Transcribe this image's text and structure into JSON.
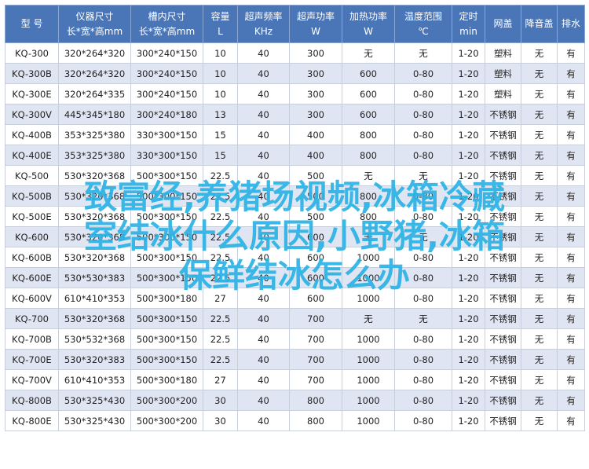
{
  "table": {
    "columns": [
      {
        "line1": "型  号",
        "line2": ""
      },
      {
        "line1": "仪器尺寸",
        "line2": "长*宽*高mm"
      },
      {
        "line1": "槽内尺寸",
        "line2": "长*宽*高mm"
      },
      {
        "line1": "容量",
        "line2": "L"
      },
      {
        "line1": "超声频率",
        "line2": "KHz"
      },
      {
        "line1": "超声功率",
        "line2": "W"
      },
      {
        "line1": "加热功率",
        "line2": "W"
      },
      {
        "line1": "温度范围",
        "line2": "℃"
      },
      {
        "line1": "定时",
        "line2": "min"
      },
      {
        "line1": "网盖",
        "line2": ""
      },
      {
        "line1": "降音盖",
        "line2": ""
      },
      {
        "line1": "排水",
        "line2": ""
      }
    ],
    "rows": [
      [
        "KQ-300",
        "320*264*320",
        "300*240*150",
        "10",
        "40",
        "300",
        "无",
        "无",
        "1-20",
        "塑料",
        "无",
        "有"
      ],
      [
        "KQ-300B",
        "320*264*320",
        "300*240*150",
        "10",
        "40",
        "300",
        "600",
        "0-80",
        "1-20",
        "塑料",
        "无",
        "有"
      ],
      [
        "KQ-300E",
        "320*264*335",
        "300*240*150",
        "10",
        "40",
        "300",
        "600",
        "0-80",
        "1-20",
        "塑料",
        "无",
        "有"
      ],
      [
        "KQ-300V",
        "445*345*180",
        "300*240*180",
        "13",
        "40",
        "300",
        "600",
        "0-80",
        "1-20",
        "不锈钢",
        "无",
        "有"
      ],
      [
        "KQ-400B",
        "353*325*380",
        "330*300*150",
        "15",
        "40",
        "400",
        "800",
        "0-80",
        "1-20",
        "不锈钢",
        "无",
        "有"
      ],
      [
        "KQ-400E",
        "353*325*380",
        "330*300*150",
        "15",
        "40",
        "400",
        "800",
        "0-80",
        "1-20",
        "不锈钢",
        "无",
        "有"
      ],
      [
        "KQ-500",
        "530*320*368",
        "500*300*150",
        "22.5",
        "40",
        "500",
        "无",
        "无",
        "1-20",
        "不锈钢",
        "无",
        "有"
      ],
      [
        "KQ-500B",
        "530*320*368",
        "500*300*150",
        "22.5",
        "40",
        "500",
        "800",
        "0-80",
        "1-20",
        "不锈钢",
        "无",
        "有"
      ],
      [
        "KQ-500E",
        "530*320*368",
        "500*300*150",
        "22.5",
        "40",
        "500",
        "800",
        "0-80",
        "1-20",
        "不锈钢",
        "无",
        "有"
      ],
      [
        "KQ-600",
        "530*320*368",
        "500*300*150",
        "22.5",
        "40",
        "600",
        "无",
        "无",
        "1-20",
        "不锈钢",
        "无",
        "有"
      ],
      [
        "KQ-600B",
        "530*320*368",
        "500*300*150",
        "22.5",
        "40",
        "600",
        "1000",
        "0-80",
        "1-20",
        "不锈钢",
        "无",
        "有"
      ],
      [
        "KQ-600E",
        "530*530*383",
        "500*300*150",
        "22.5",
        "40",
        "600",
        "1000",
        "0-80",
        "1-20",
        "不锈钢",
        "无",
        "有"
      ],
      [
        "KQ-600V",
        "610*410*353",
        "500*300*180",
        "27",
        "40",
        "600",
        "1000",
        "0-80",
        "1-20",
        "不锈钢",
        "无",
        "有"
      ],
      [
        "KQ-700",
        "530*320*368",
        "500*300*150",
        "22.5",
        "40",
        "700",
        "无",
        "无",
        "1-20",
        "不锈钢",
        "无",
        "有"
      ],
      [
        "KQ-700B",
        "530*532*368",
        "500*300*150",
        "22.5",
        "40",
        "700",
        "1000",
        "0-80",
        "1-20",
        "不锈钢",
        "无",
        "有"
      ],
      [
        "KQ-700E",
        "530*320*383",
        "500*300*150",
        "22.5",
        "40",
        "700",
        "1000",
        "0-80",
        "1-20",
        "不锈钢",
        "无",
        "有"
      ],
      [
        "KQ-700V",
        "610*410*353",
        "500*300*180",
        "27",
        "40",
        "700",
        "1000",
        "0-80",
        "1-20",
        "不锈钢",
        "无",
        "有"
      ],
      [
        "KQ-800B",
        "530*325*430",
        "500*300*200",
        "30",
        "40",
        "800",
        "1000",
        "0-80",
        "1-20",
        "不锈钢",
        "无",
        "有"
      ],
      [
        "KQ-800E",
        "530*325*430",
        "500*300*200",
        "30",
        "40",
        "800",
        "1000",
        "0-80",
        "1-20",
        "不锈钢",
        "无",
        "有"
      ]
    ]
  },
  "overlay": {
    "line1": "致富经,养猪场视频,冰箱冷藏",
    "line2": "室结冰什么原因,小野猪,冰箱",
    "line3": "保鲜结冰怎么办"
  },
  "colors": {
    "header_bg": "#4a76b8",
    "row_alt_bg": "#dfe5f2",
    "overlay_text": "#2bb3e6"
  }
}
